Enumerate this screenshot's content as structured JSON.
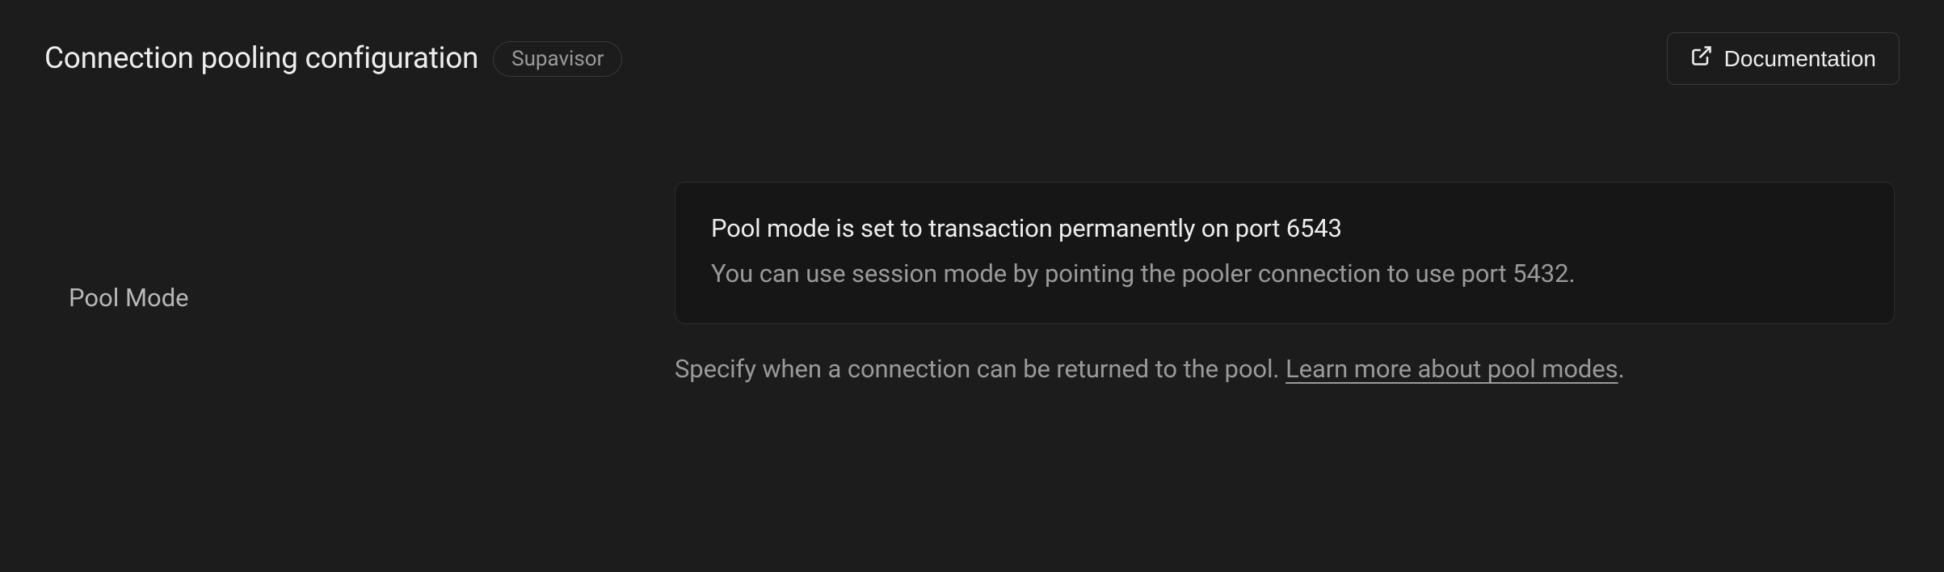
{
  "header": {
    "title": "Connection pooling configuration",
    "badge": "Supavisor",
    "documentation_label": "Documentation"
  },
  "field": {
    "label": "Pool Mode",
    "info_title": "Pool mode is set to transaction permanently on port 6543",
    "info_desc": "You can use session mode by pointing the pooler connection to use port 5432.",
    "help_prefix": "Specify when a connection can be returned to the pool. ",
    "help_link": "Learn more about pool modes",
    "help_suffix": "."
  }
}
